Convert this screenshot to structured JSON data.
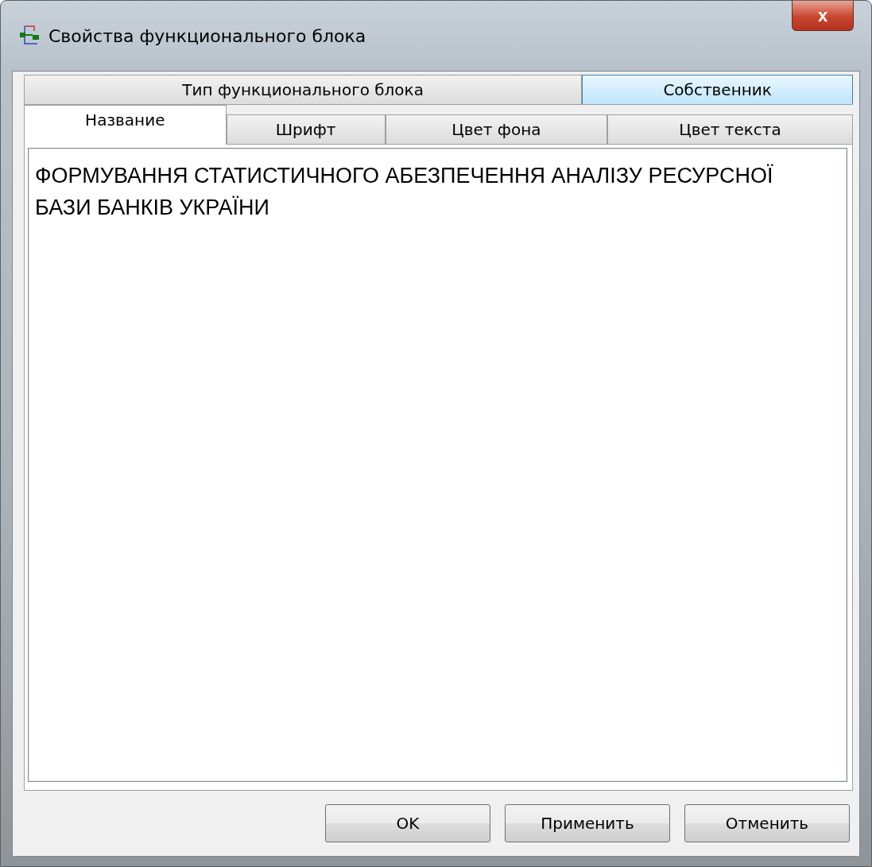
{
  "window": {
    "title": "Свойства функционального блока",
    "close": "x"
  },
  "tab_rows": [
    [
      {
        "label": "Тип функционального блока",
        "selected": false,
        "hovered": false
      },
      {
        "label": "Собственник",
        "selected": false,
        "hovered": true
      }
    ],
    [
      {
        "label": "Название",
        "selected": true,
        "hovered": false
      },
      {
        "label": "Шрифт",
        "selected": false,
        "hovered": false
      },
      {
        "label": "Цвет фона",
        "selected": false,
        "hovered": false
      },
      {
        "label": "Цвет текста",
        "selected": false,
        "hovered": false
      }
    ]
  ],
  "name_field": {
    "value": "ФОРМУВАННЯ СТАТИСТИЧНОГО АБЕЗПЕЧЕННЯ АНАЛІЗУ РЕСУРСНОЇ БАЗИ БАНКІВ УКРАЇНИ"
  },
  "buttons": [
    "OK",
    "Применить",
    "Отменить"
  ]
}
